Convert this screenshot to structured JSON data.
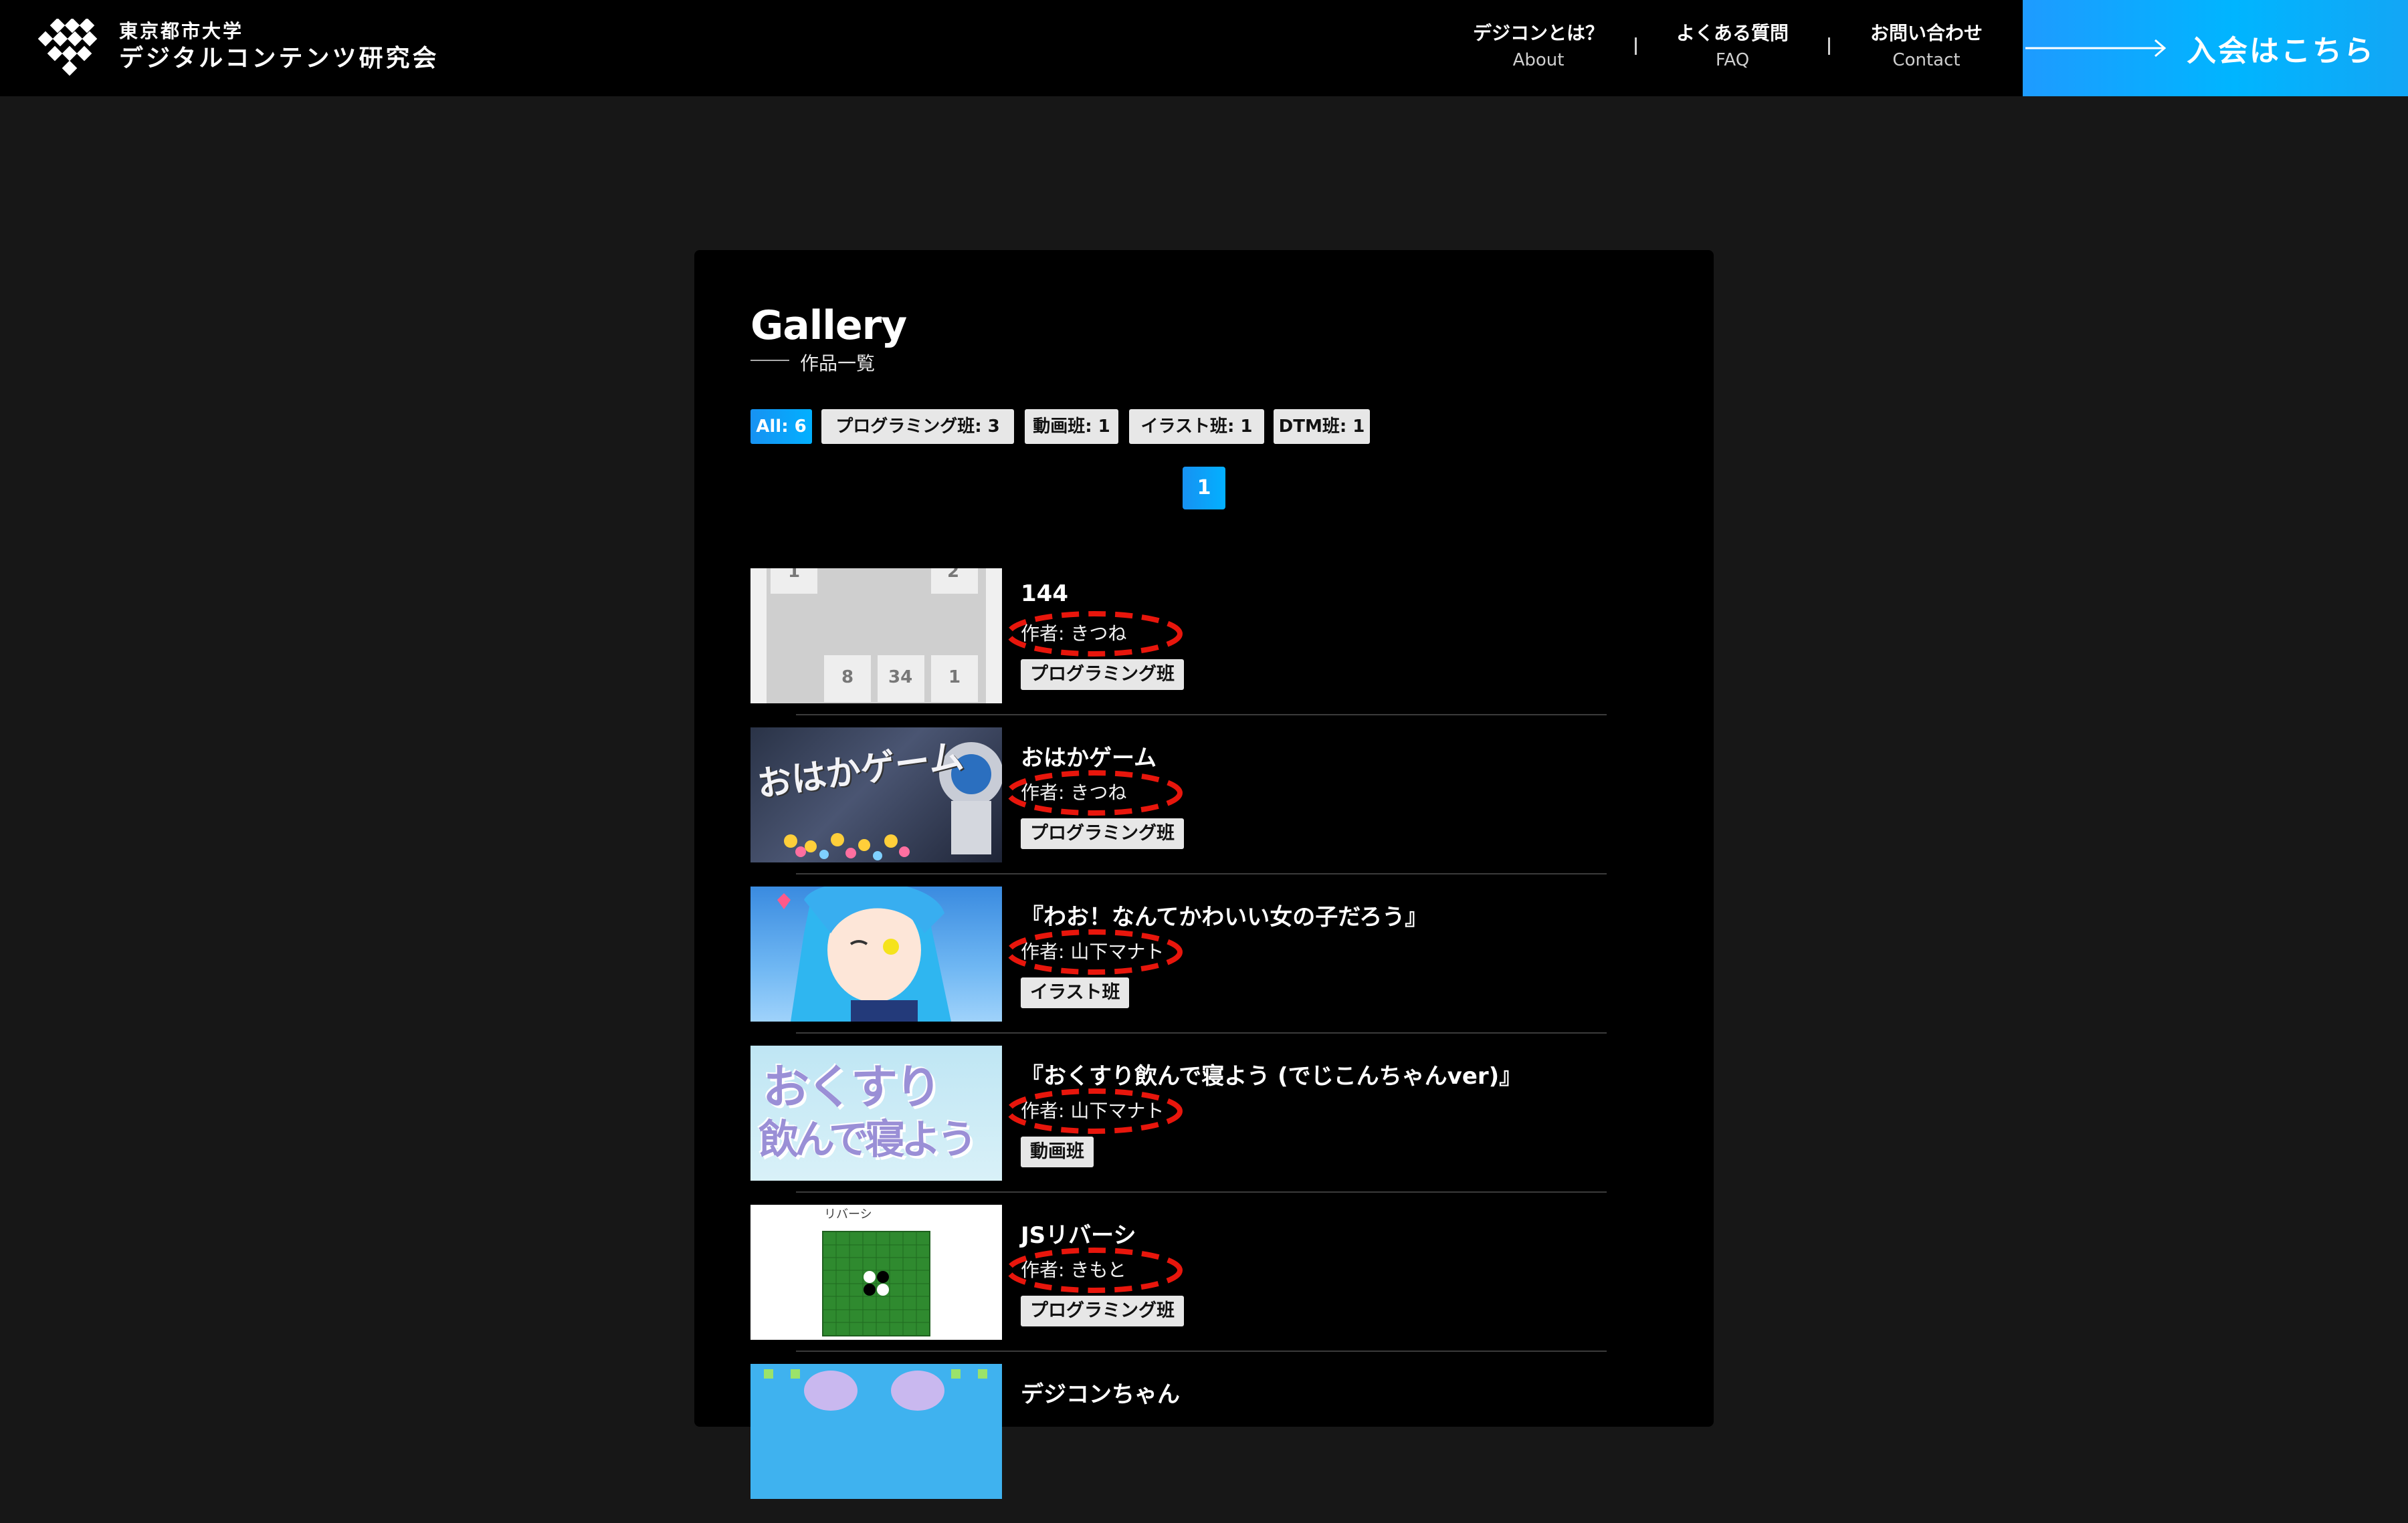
{
  "header": {
    "logo_line1": "東京都市大学",
    "logo_line2": "デジタルコンテンツ研究会",
    "nav": [
      {
        "jp": "デジコンとは？",
        "en": "About"
      },
      {
        "jp": "よくある質問",
        "en": "FAQ"
      },
      {
        "jp": "お問い合わせ",
        "en": "Contact"
      }
    ],
    "join_label": "入会はこちら",
    "join_color": "#1e9bff"
  },
  "gallery": {
    "title": "Gallery",
    "subtitle": "作品一覧",
    "filters": [
      "All: 6",
      "プログラミング班: 3",
      "動画班: 1",
      "イラスト班: 1",
      "DTM班: 1"
    ],
    "active_filter": "All: 6",
    "page": "1",
    "items": [
      {
        "title": "144",
        "author": "作者: きつね",
        "tag": "プログラミング班",
        "thumb_numbers": [
          "1",
          "2",
          "8",
          "34",
          "1"
        ]
      },
      {
        "title": "おはかゲーム",
        "author": "作者: きつね",
        "tag": "プログラミング班",
        "thumb_text": "おはかゲーム"
      },
      {
        "title": "『わお！なんてかわいい女の子だろう』",
        "author": "作者: 山下マナト",
        "tag": "イラスト班"
      },
      {
        "title": "『おくすり飲んで寝よう (でじこんちゃんver)』",
        "author": "作者: 山下マナト",
        "tag": "動画班",
        "thumb_text_1": "おくすり",
        "thumb_text_2": "飲んで寝よう"
      },
      {
        "title": "JSリバーシ",
        "author": "作者: きもと",
        "tag": "プログラミング班",
        "thumb_text": "リバーシ"
      },
      {
        "title": "デジコンちゃん",
        "author": "",
        "tag": ""
      }
    ],
    "highlight_color": "#e8160c"
  }
}
